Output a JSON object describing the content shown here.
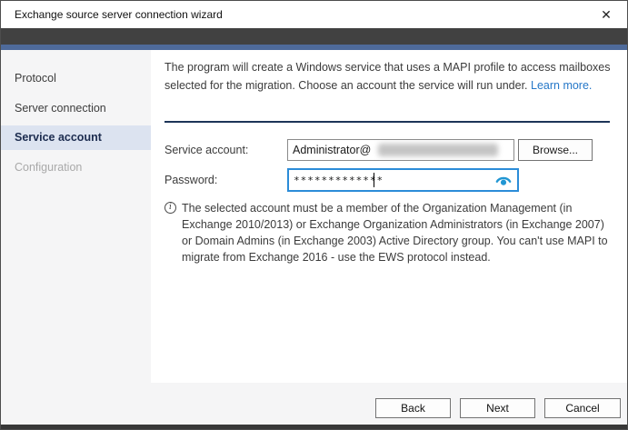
{
  "window": {
    "title": "Exchange source server connection wizard",
    "close_icon": "✕"
  },
  "sidebar": {
    "items": [
      {
        "label": "Protocol",
        "state": "normal"
      },
      {
        "label": "Server connection",
        "state": "normal"
      },
      {
        "label": "Service account",
        "state": "selected"
      },
      {
        "label": "Configuration",
        "state": "disabled"
      }
    ]
  },
  "main": {
    "intro": {
      "text": "The program will create a Windows service that uses a MAPI profile to access mailboxes selected for the migration. Choose an account the service will run under. ",
      "link_label": "Learn more."
    },
    "form": {
      "service_account": {
        "label": "Service account:",
        "value": "Administrator@",
        "value_redacted_suffix": true,
        "browse_label": "Browse..."
      },
      "password": {
        "label": "Password:",
        "masked_value": "*************",
        "reveal_icon": "eye-icon",
        "focused": true
      }
    },
    "note": {
      "icon": "info-icon",
      "info_glyph": "i",
      "text": "The selected account must be a member of the Organization Management (in Exchange 2010/2013) or Exchange Organization Administrators (in Exchange 2007) or Domain Admins (in Exchange 2003) Active Directory group. You can't use MAPI to migrate from Exchange 2016 - use the EWS protocol instead."
    }
  },
  "footer": {
    "back_label": "Back",
    "next_label": "Next",
    "cancel_label": "Cancel"
  },
  "colors": {
    "header_dark_band": "#414141",
    "header_blue_band": "#4e6a9a",
    "sidebar_bg": "#f5f5f6",
    "selected_item_bg": "#dce3f0",
    "selected_item_text": "#1c2c4f",
    "disabled_item_text": "#a9a9a9",
    "link": "#2577c8",
    "separator": "#1d3458",
    "focus_border": "#2b8cd8",
    "eye_icon": "#2196d3",
    "bottom_strip": "#383838"
  }
}
